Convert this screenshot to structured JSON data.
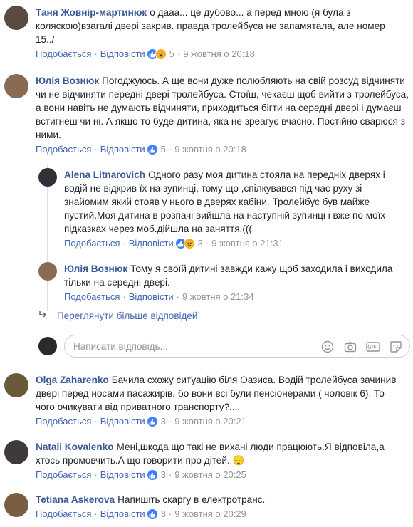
{
  "comments": [
    {
      "author": "Таня Жовнір-мартинюк",
      "text": "о дааа... це дубово... а перед мною (я була з коляскою)взагалі двері закрив. правда тролейбуса не запамятала, але номер 15../",
      "like_label": "Подобається",
      "reply_label": "Відповісти",
      "reaction_count": "5",
      "time": "9 жовтня о 20:18",
      "avatar_color": "#5a4a42"
    },
    {
      "author": "Юлія Вознюк",
      "text": "Погоджуюсь. А ще вони дуже полюбляють на свій розсуд відчиняти чи не відчиняти передні двері тролейбуса. Стоїш, чекаєш щоб вийти з тролейбуса, а вони навіть не думають відчиняти, приходиться бігти на середні двері і думаєш встигнеш чи ні. А якщо то буде дитина, яка не зреагує вчасно. Постійно сварюся з ними.",
      "like_label": "Подобається",
      "reply_label": "Відповісти",
      "reaction_count": "5",
      "time": "9 жовтня о 20:18",
      "avatar_color": "#8a6a52"
    },
    {
      "author": "Olga Zaharenko",
      "text": "Бачила схожу ситуацію біля Оазиса. Водій тролейбуса зачинив двері перед носами пасажирів, бо вони всі були пенсіонерами ( чоловік 6). То чого очикувати від приватного транспорту?....",
      "like_label": "Подобається",
      "reply_label": "Відповісти",
      "reaction_count": "3",
      "time": "9 жовтня о 20:21",
      "avatar_color": "#6b5a3a"
    },
    {
      "author": "Natali Kovalenko",
      "text": "Мені,шкода що такі не вихані люди працюють.Я відповіла,а хтось промовчить.А що говорити про дітей. 😔",
      "like_label": "Подобається",
      "reply_label": "Відповісти",
      "reaction_count": "3",
      "time": "9 жовтня о 20:25",
      "avatar_color": "#3e3a3c"
    },
    {
      "author": "Tetiana Askerova",
      "text": "Напишіть скаргу в електротранс.",
      "like_label": "Подобається",
      "reply_label": "Відповісти",
      "reaction_count": "3",
      "time": "9 жовтня о 20:29",
      "avatar_color": "#7a5e44"
    }
  ],
  "replies": [
    {
      "author": "Alena Litnarovich",
      "text": "Одного разу моя дитина стояла на передніх дверях і водій не відкрив їх на зупинці, тому що ,спілкувався під час руху зі знайомим який стояв у нього в дверях кабіни. Тролейбус був майже пустий.Моя дитина в розпачі вийшла на наступній зупинці і вже по моїх підказках через моб.дійшла на заняття.(((",
      "like_label": "Подобається",
      "reply_label": "Відповісти",
      "reaction_count": "3",
      "time": "9 жовтня о 21:31",
      "avatar_color": "#2e3138"
    },
    {
      "author": "Юлія Вознюк",
      "text": "Тому я своїй дитині завжди кажу щоб заходила і виходила тільки на середні двері.",
      "like_label": "Подобається",
      "reply_label": "Відповісти",
      "time": "9 жовтня о 21:34",
      "avatar_color": "#8a6a52"
    }
  ],
  "more_replies_label": "Переглянути більше відповідей",
  "reply_input": {
    "placeholder": "Написати відповідь...",
    "avatar_color": "#2a2a2a"
  },
  "separator": "·",
  "colors": {
    "link": "#4267b2",
    "author": "#385898",
    "meta": "#90949c",
    "like_badge": "#4080ff",
    "haha_badge": "#f7b125"
  }
}
